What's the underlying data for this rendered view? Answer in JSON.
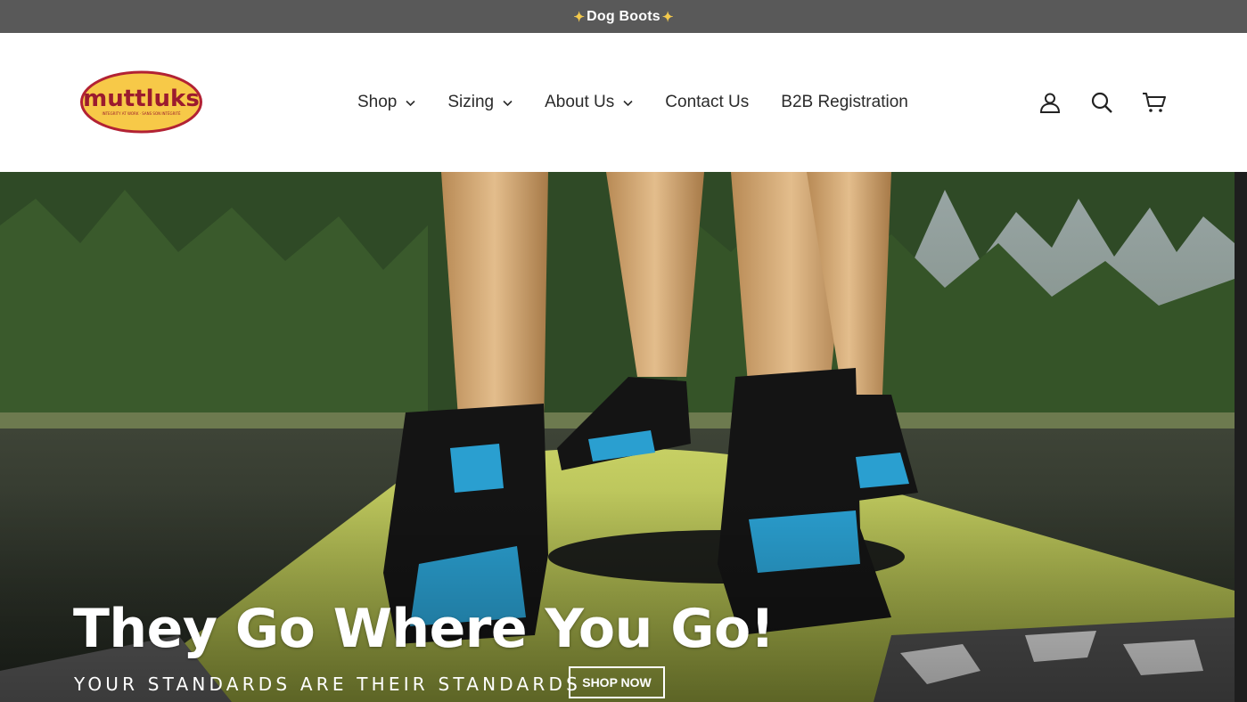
{
  "announcement": {
    "text": "Dog Boots",
    "icon_left": "confetti-icon",
    "icon_right": "confetti-icon"
  },
  "header": {
    "logo_text": "muttluks",
    "logo_tagline": "INTEGRITY AT WORK · SANS SON INTÉGRITÉ",
    "nav": [
      {
        "label": "Shop",
        "has_dropdown": true
      },
      {
        "label": "Sizing",
        "has_dropdown": true
      },
      {
        "label": "About Us",
        "has_dropdown": true
      },
      {
        "label": "Contact Us",
        "has_dropdown": false
      },
      {
        "label": "B2B Registration",
        "has_dropdown": false
      }
    ],
    "icons": [
      "account-icon",
      "search-icon",
      "cart-icon"
    ]
  },
  "hero": {
    "title": "They Go Where You Go!",
    "subtitle": "YOUR STANDARDS ARE THEIR STANDARDS",
    "button_label": "SHOP NOW"
  },
  "colors": {
    "announcement_bg": "#595959",
    "logo_fill": "#f7c948",
    "logo_red": "#b22234",
    "text_dark": "#2b2b2b",
    "white": "#ffffff"
  }
}
